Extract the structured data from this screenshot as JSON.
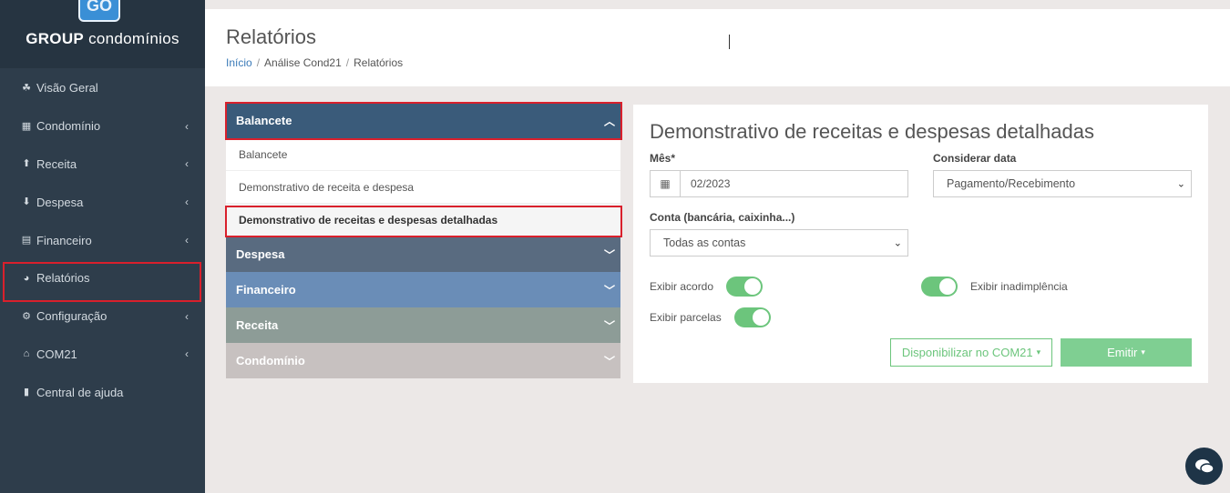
{
  "brand": {
    "bold": "GROUP",
    "light": "condomínios",
    "logo_text": "GO"
  },
  "sidebar": {
    "items": [
      {
        "label": "Visão Geral",
        "icon": "tachometer-icon",
        "glyph": "☘",
        "has_chevron": false
      },
      {
        "label": "Condomínio",
        "icon": "building-icon",
        "glyph": "▦",
        "has_chevron": true
      },
      {
        "label": "Receita",
        "icon": "arrow-circle-up-icon",
        "glyph": "⬆",
        "has_chevron": true
      },
      {
        "label": "Despesa",
        "icon": "arrow-circle-down-icon",
        "glyph": "⬇",
        "has_chevron": true
      },
      {
        "label": "Financeiro",
        "icon": "calculator-icon",
        "glyph": "▤",
        "has_chevron": true
      },
      {
        "label": "Relatórios",
        "icon": "pie-chart-icon",
        "glyph": "◕",
        "has_chevron": false
      },
      {
        "label": "Configuração",
        "icon": "gear-icon",
        "glyph": "⚙",
        "has_chevron": true
      },
      {
        "label": "COM21",
        "icon": "home-icon",
        "glyph": "⌂",
        "has_chevron": true
      },
      {
        "label": "Central de ajuda",
        "icon": "book-icon",
        "glyph": "▮",
        "has_chevron": false
      }
    ]
  },
  "header": {
    "title": "Relatórios",
    "breadcrumb": [
      "Início",
      "Análise Cond21",
      "Relatórios"
    ]
  },
  "accordion": {
    "sections": [
      {
        "label": "Balancete",
        "color": "#3a5b7a",
        "expanded": true,
        "items": [
          "Balancete",
          "Demonstrativo de receita e despesa",
          "Demonstrativo de receitas e despesas detalhadas"
        ]
      },
      {
        "label": "Despesa",
        "color": "#596b80",
        "expanded": false
      },
      {
        "label": "Financeiro",
        "color": "#6a8db7",
        "expanded": false
      },
      {
        "label": "Receita",
        "color": "#8d9c97",
        "expanded": false
      },
      {
        "label": "Condomínio",
        "color": "#c7c1c0",
        "expanded": false
      }
    ]
  },
  "form": {
    "title": "Demonstrativo de receitas e despesas detalhadas",
    "mes_label": "Mês*",
    "mes_value": "02/2023",
    "considerar_label": "Considerar data",
    "considerar_value": "Pagamento/Recebimento",
    "conta_label": "Conta (bancária, caixinha...)",
    "conta_value": "Todas as contas",
    "toggles": {
      "acordo": {
        "label": "Exibir acordo",
        "on": true
      },
      "inadimplencia": {
        "label": "Exibir inadimplência",
        "on": true
      },
      "parcelas": {
        "label": "Exibir parcelas",
        "on": true
      }
    },
    "btn_disponibilizar": "Disponibilizar no COM21",
    "btn_emitir": "Emitir"
  },
  "colors": {
    "sidebar": "#2e3d4b",
    "accent_green": "#6cc57c",
    "highlight_red": "#d9202c"
  }
}
